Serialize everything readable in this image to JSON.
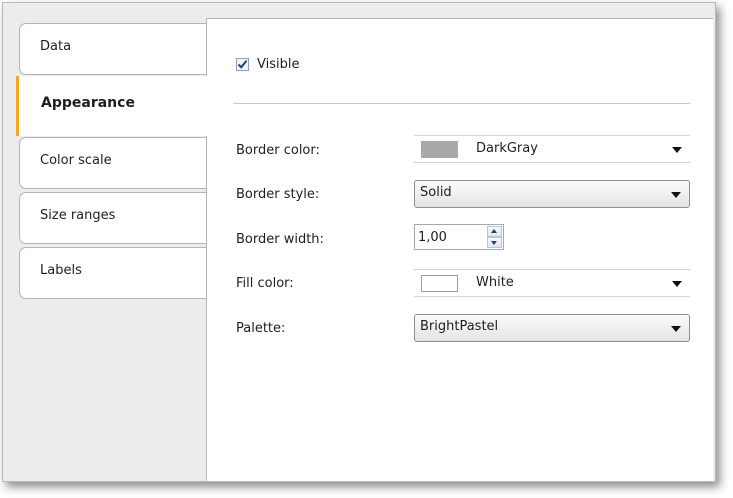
{
  "tabs": [
    {
      "label": "Data",
      "active": false
    },
    {
      "label": "Appearance",
      "active": true
    },
    {
      "label": "Color scale",
      "active": false
    },
    {
      "label": "Size ranges",
      "active": false
    },
    {
      "label": "Labels",
      "active": false
    }
  ],
  "visible": {
    "label": "Visible",
    "checked": true
  },
  "border_color": {
    "label": "Border color:",
    "value": "DarkGray",
    "swatch": "#a9a9a9"
  },
  "border_style": {
    "label": "Border style:",
    "value": "Solid"
  },
  "border_width": {
    "label": "Border width:",
    "value": "1,00"
  },
  "fill_color": {
    "label": "Fill color:",
    "value": "White",
    "swatch": "#ffffff"
  },
  "palette": {
    "label": "Palette:",
    "value": "BrightPastel"
  },
  "colors": {
    "accent": "#f5a623",
    "check": "#1f3d7a"
  }
}
